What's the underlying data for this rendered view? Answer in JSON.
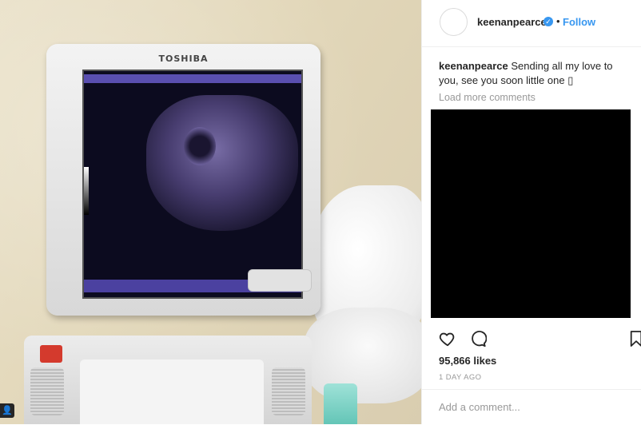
{
  "post": {
    "username": "keenanpearce",
    "follow_label": "Follow",
    "separator": "•",
    "verified_glyph": "✓",
    "caption_user": "keenanpearce",
    "caption_text": "Sending all my love to you, see you soon little one",
    "caption_emoji_glyph": "▯",
    "load_more": "Load more comments",
    "likes": "95,866 likes",
    "time": "1 DAY AGO",
    "add_comment_placeholder": "Add a comment..."
  },
  "photo": {
    "monitor_brand": "TOSHIBA",
    "corner_icon_glyph": "👤"
  },
  "colors": {
    "accent": "#3897f0",
    "text": "#262626",
    "muted": "#999999",
    "border": "#efefef"
  },
  "icons": {
    "heart": "heart-outline-icon",
    "comment": "comment-bubble-icon",
    "bookmark": "bookmark-icon",
    "verified": "verified-badge-icon"
  }
}
